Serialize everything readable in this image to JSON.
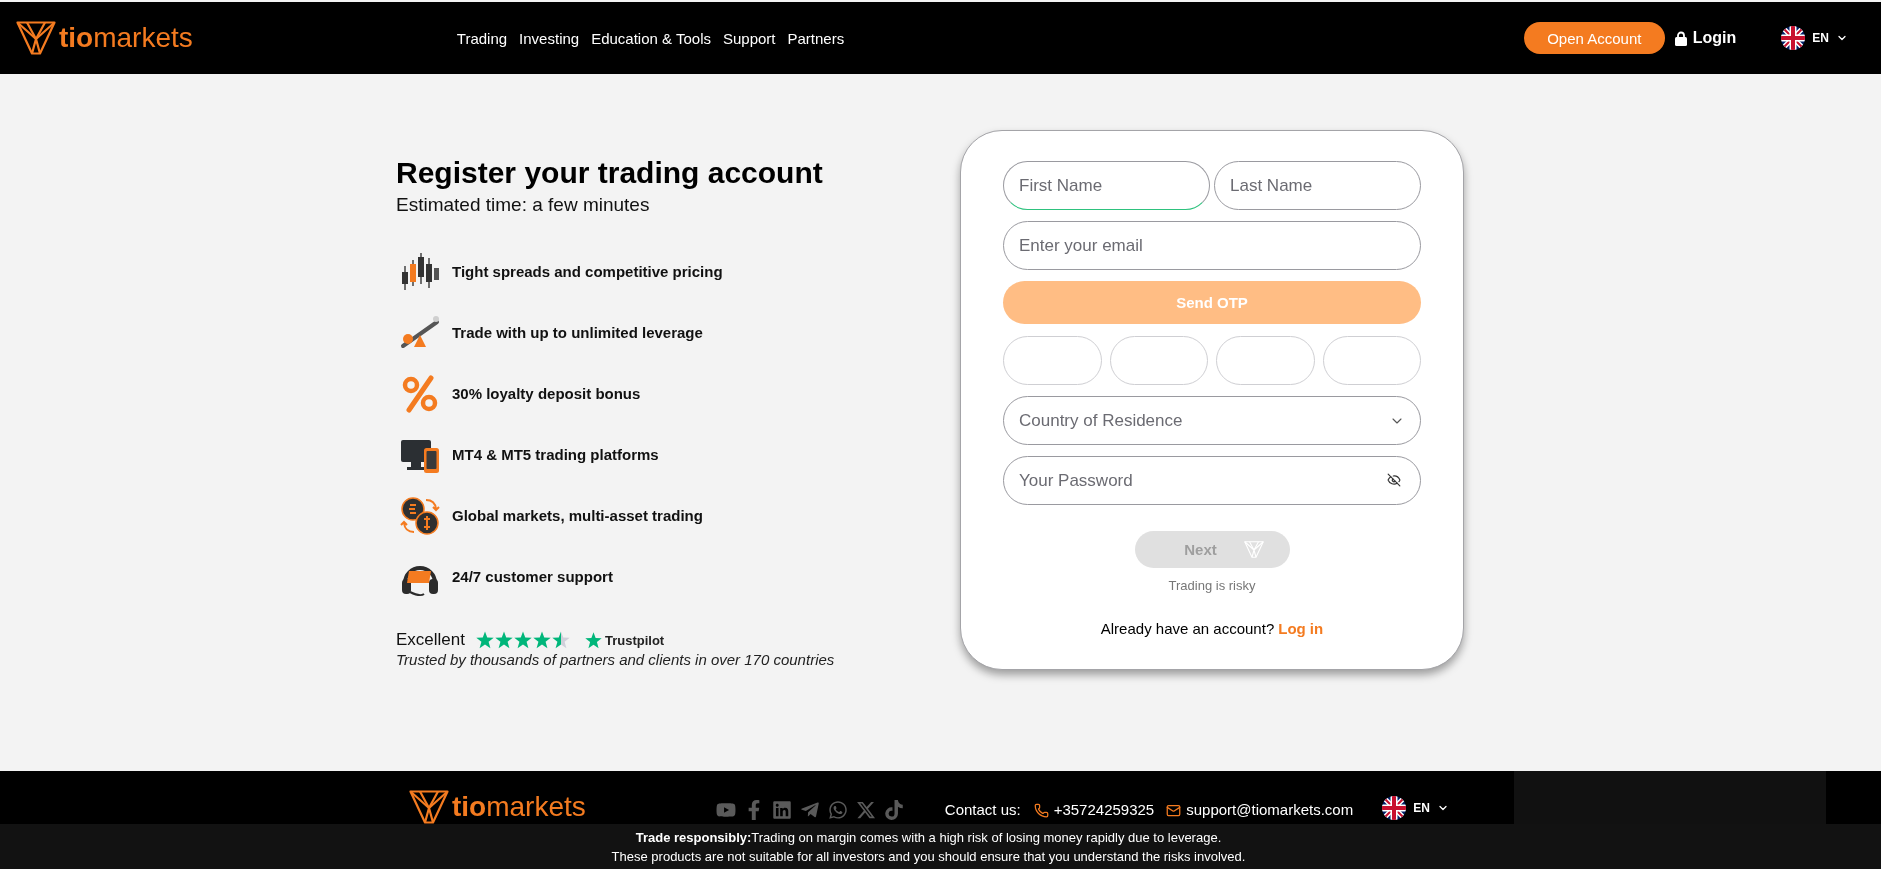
{
  "header": {
    "logo": "**tio**markets",
    "nav": [
      {
        "label": "Trading"
      },
      {
        "label": "Investing"
      },
      {
        "label": "Education & Tools"
      },
      {
        "label": "Support"
      },
      {
        "label": "Partners"
      }
    ],
    "open_account": "Open Account",
    "login": "Login",
    "language": "EN"
  },
  "intro": {
    "title": "Register your trading account",
    "subtitle": "Estimated time: a few minutes"
  },
  "features": [
    {
      "kind": "candles",
      "text": "Tight spreads and competitive pricing"
    },
    {
      "kind": "seesaw",
      "text": "Trade with up to unlimited leverage"
    },
    {
      "kind": "percent",
      "text": "30% loyalty deposit bonus"
    },
    {
      "kind": "devices",
      "text": "MT4 & MT5 trading platforms"
    },
    {
      "kind": "exchange",
      "text": "Global markets, multi-asset trading"
    },
    {
      "kind": "headset",
      "text": "24/7 customer support"
    }
  ],
  "trustpilot": {
    "rating_label": "Excellent",
    "stars": 4.5,
    "brand": "Trustpilot",
    "tagline": "Trusted by thousands of partners and clients in over 170 countries"
  },
  "form": {
    "name_fields": [
      {
        "placeholder": "First Name",
        "focused": true
      },
      {
        "placeholder": "Last Name",
        "focused": false
      }
    ],
    "email": {
      "placeholder": "Enter your email"
    },
    "send_otp": {
      "label": "Send OTP",
      "disabled": true
    },
    "otp_fields": [
      {
        "focused": false
      },
      {
        "focused": false
      },
      {
        "focused": false
      },
      {
        "focused": false
      }
    ],
    "country": {
      "placeholder": "Country of Residence"
    },
    "password": {
      "placeholder": "Your Password",
      "visible": false
    },
    "next": {
      "label": "Next",
      "disabled": true
    },
    "risk_note": "Trading is risky",
    "login_prompt": "Already have an account?",
    "login_link": "Log in"
  },
  "footer": {
    "logo": "**tio**markets",
    "contact_label": "Contact us:",
    "phone": "+35724259325",
    "email": "support@tiomarkets.com",
    "language": "EN",
    "disclaimer": [
      "**Trade responsibly:**Trading on margin comes with a high risk of losing money rapidly due to leverage.",
      "These products are not suitable for all investors and you should ensure that you understand the risks involved."
    ]
  }
}
